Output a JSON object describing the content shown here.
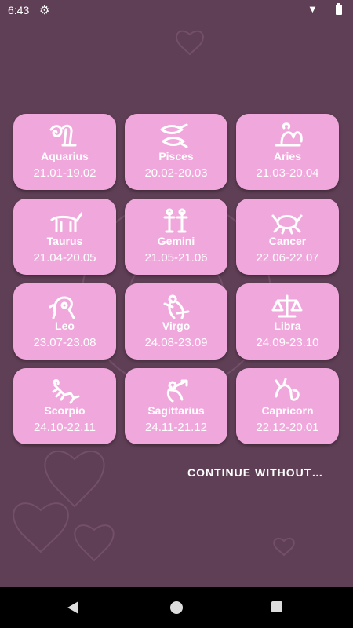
{
  "status": {
    "time": "6:43"
  },
  "signs": [
    {
      "name": "Aquarius",
      "dates": "21.01-19.02",
      "icon": "aquarius-icon"
    },
    {
      "name": "Pisces",
      "dates": "20.02-20.03",
      "icon": "pisces-icon"
    },
    {
      "name": "Aries",
      "dates": "21.03-20.04",
      "icon": "aries-icon"
    },
    {
      "name": "Taurus",
      "dates": "21.04-20.05",
      "icon": "taurus-icon"
    },
    {
      "name": "Gemini",
      "dates": "21.05-21.06",
      "icon": "gemini-icon"
    },
    {
      "name": "Cancer",
      "dates": "22.06-22.07",
      "icon": "cancer-icon"
    },
    {
      "name": "Leo",
      "dates": "23.07-23.08",
      "icon": "leo-icon"
    },
    {
      "name": "Virgo",
      "dates": "24.08-23.09",
      "icon": "virgo-icon"
    },
    {
      "name": "Libra",
      "dates": "24.09-23.10",
      "icon": "libra-icon"
    },
    {
      "name": "Scorpio",
      "dates": "24.10-22.11",
      "icon": "scorpio-icon"
    },
    {
      "name": "Sagittarius",
      "dates": "24.11-21.12",
      "icon": "sagittarius-icon"
    },
    {
      "name": "Capricorn",
      "dates": "22.12-20.01",
      "icon": "capricorn-icon"
    }
  ],
  "continue_label": "CONTINUE WITHOUT…",
  "colors": {
    "background": "#5f3f55",
    "card": "#f0a7dc",
    "text": "#ffffff"
  }
}
